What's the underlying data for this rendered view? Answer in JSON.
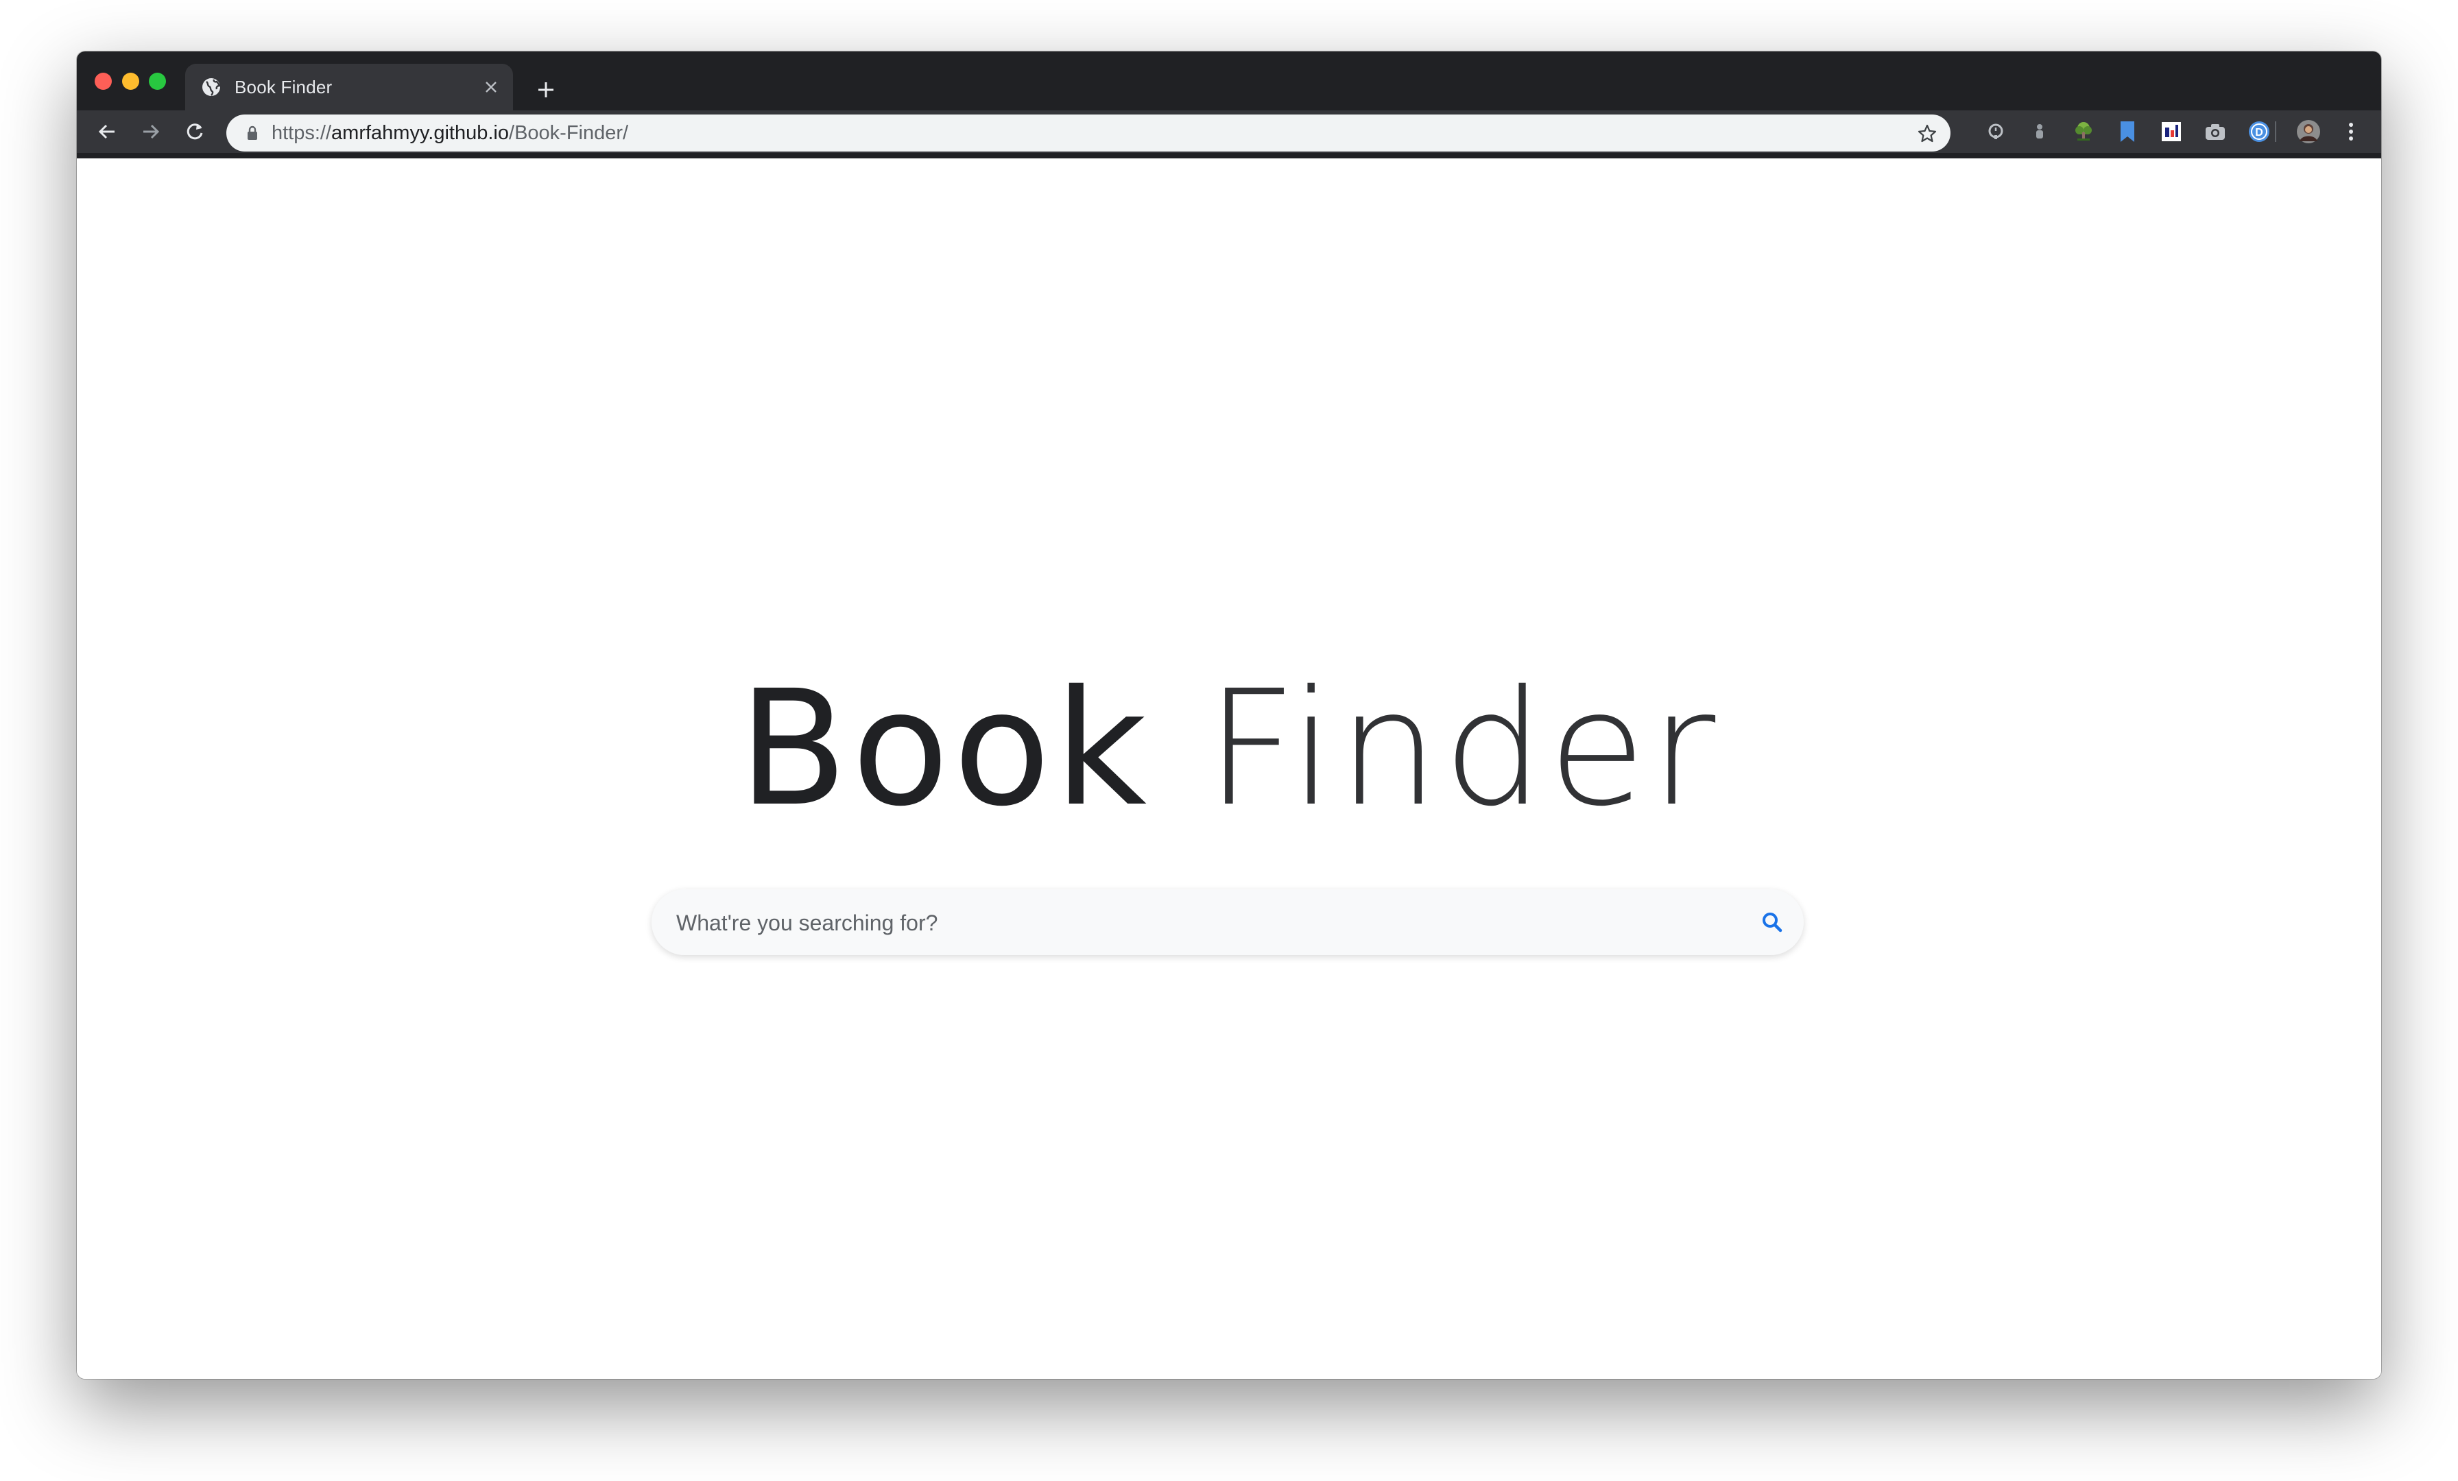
{
  "tab": {
    "title": "Book Finder",
    "favicon": "globe-icon"
  },
  "address_bar": {
    "scheme": "https://",
    "host": "amrfahmyy.github.io",
    "path": "/Book-Finder/"
  },
  "toolbar_icons": [
    "back-arrow-icon",
    "forward-arrow-icon",
    "reload-icon",
    "lock-icon",
    "star-icon",
    "kebab-menu-icon"
  ],
  "extensions": [
    "alarm-extension-icon",
    "figure-extension-icon",
    "tree-extension-icon",
    "bookmark-extension-icon",
    "chart-extension-icon",
    "camera-extension-icon",
    "d-badge-extension-icon",
    "avatar"
  ],
  "page": {
    "logo_word_1": "Book",
    "logo_word_2": "Finder",
    "search": {
      "placeholder": "What're you searching for?",
      "value": ""
    }
  },
  "colors": {
    "titlebar": "#202124",
    "toolbar": "#35363a",
    "omnibox": "#f1f3f4",
    "accent_blue": "#1a73e8",
    "text_dark": "#202124",
    "search_bg": "#f8f9fa"
  }
}
